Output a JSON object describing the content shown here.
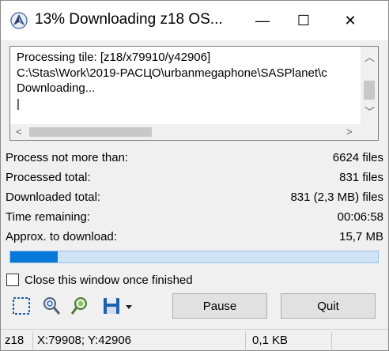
{
  "window": {
    "title": "13% Downloading z18 OS...",
    "minimize_glyph": "—",
    "maximize_glyph": "☐",
    "close_glyph": "✕"
  },
  "log": {
    "lines": "Processing tile: [z18/x79910/y42906]\nC:\\Stas\\Work\\2019-РАСЦО\\urbanmegaphone\\SASPlanet\\c\nDownloading...\n|"
  },
  "stats": [
    {
      "label": "Process not more than:",
      "value": "6624 files"
    },
    {
      "label": "Processed total:",
      "value": "831 files"
    },
    {
      "label": "Downloaded total:",
      "value": "831 (2,3 MB) files"
    },
    {
      "label": "Time remaining:",
      "value": "00:06:58"
    },
    {
      "label": "Approx. to download:",
      "value": "15,7 MB"
    }
  ],
  "progress": {
    "percent": 13
  },
  "checkbox": {
    "label": "Close this window once finished",
    "checked": false
  },
  "toolbar": {
    "icons": [
      "select-area-icon",
      "zoom-to-area-icon",
      "zoom-search-icon",
      "save-icon",
      "save-dropdown-icon"
    ],
    "pause_label": "Pause",
    "quit_label": "Quit"
  },
  "statusbar": {
    "zoom": "z18",
    "coords": "X:79908; Y:42906",
    "size": "0,1 KB"
  },
  "colors": {
    "progress_fill": "#0678d7",
    "progress_track": "#cfe3f7"
  }
}
